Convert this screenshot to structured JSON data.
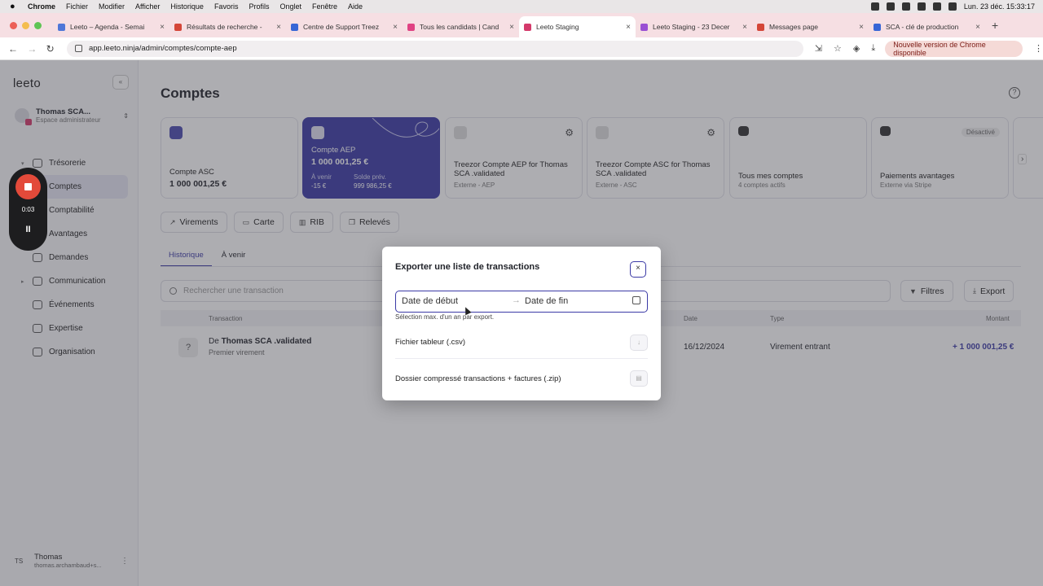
{
  "os": {
    "menu": [
      "Chrome",
      "Fichier",
      "Modifier",
      "Afficher",
      "Historique",
      "Favoris",
      "Profils",
      "Onglet",
      "Fenêtre",
      "Aide"
    ],
    "clock": "Lun. 23 déc.  15:33:17"
  },
  "tabs": [
    {
      "title": "Leeto – Agenda - Semai",
      "color": "#4f77d8"
    },
    {
      "title": "Résultats de recherche -",
      "color": "#d44638"
    },
    {
      "title": "Centre de Support Treez",
      "color": "#3766d6"
    },
    {
      "title": "Tous les candidats | Cand",
      "color": "#e04283"
    },
    {
      "title": "Leeto Staging",
      "color": "#d43a6b",
      "active": true
    },
    {
      "title": "Leeto Staging - 23 Decer",
      "color": "#9a4fd3"
    },
    {
      "title": "Messages page",
      "color": "#d44638"
    },
    {
      "title": "SCA - clé de production",
      "color": "#3766d6"
    }
  ],
  "address": {
    "url": "app.leeto.ninja/admin/comptes/compte-aep",
    "update": "Nouvelle version de Chrome disponible"
  },
  "sidebar": {
    "logo": "leeto",
    "collapse": "«",
    "org_name": "Thomas SCA...",
    "org_sub": "Espace administrateur",
    "items": [
      {
        "label": "Trésorerie",
        "caret": "▾"
      },
      {
        "label": "Comptes",
        "caret": ""
      },
      {
        "label": "Comptabilité",
        "caret": ""
      },
      {
        "label": "Avantages",
        "caret": ""
      },
      {
        "label": "Demandes",
        "caret": ""
      },
      {
        "label": "Communication",
        "caret": "▸"
      },
      {
        "label": "Événements",
        "caret": ""
      },
      {
        "label": "Expertise",
        "caret": ""
      },
      {
        "label": "Organisation",
        "caret": ""
      }
    ],
    "user_initials": "TS",
    "user_name": "Thomas",
    "user_email": "thomas.archambaud+s..."
  },
  "page": {
    "title": "Comptes",
    "help": "?"
  },
  "cards": [
    {
      "name": "Compte ASC",
      "value": "1 000 001,25 €",
      "sub": ""
    },
    {
      "name": "Compte AEP",
      "value": "1 000 001,25 €",
      "sub1": "À venir",
      "sub1v": "-15 €",
      "sub2": "Solde prév.",
      "sub2v": "999 986,25 €"
    },
    {
      "name": "Treezor Compte AEP for Thomas SCA .validated",
      "sub": "Externe - AEP"
    },
    {
      "name": "Treezor Compte ASC for Thomas SCA .validated",
      "sub": "Externe - ASC"
    },
    {
      "name": "Tous mes comptes",
      "sub": "4 comptes actifs"
    },
    {
      "name": "Paiements avantages",
      "sub": "Externe via Stripe",
      "tag": "Désactivé"
    }
  ],
  "actions": [
    "Virements",
    "Carte",
    "RIB",
    "Relevés"
  ],
  "subtabs": [
    "Historique",
    "À venir"
  ],
  "search_placeholder": "Rechercher une transaction",
  "filter_label": "Filtres",
  "export_label": "Export",
  "table": {
    "headers": [
      "Transaction",
      "Date",
      "Type",
      "Montant"
    ],
    "row": {
      "from": "De ",
      "bold": "Thomas SCA .validated",
      "sub": "Premier virement",
      "date": "16/12/2024",
      "type": "Virement entrant",
      "amount": "+ 1 000 001,25 €"
    }
  },
  "recorder": {
    "time": "0:03",
    "pause": "II"
  },
  "modal": {
    "title": "Exporter une liste de transactions",
    "close": "×",
    "start": "Date de début",
    "arrow": "→",
    "end": "Date de fin",
    "hint": "Sélection max. d'un an par export.",
    "opt1": "Fichier tableur (.csv)",
    "opt2": "Dossier compressé transactions + factures (.zip)"
  }
}
